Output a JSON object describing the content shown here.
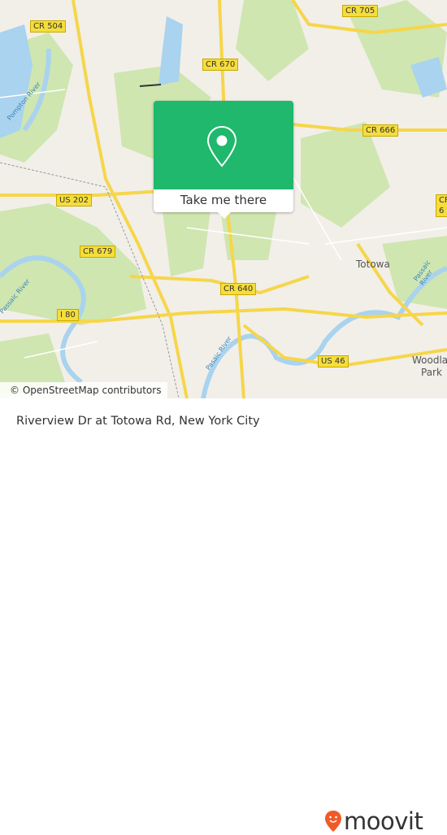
{
  "map": {
    "road_labels": [
      "CR 504",
      "CR 705",
      "CR 670",
      "CR 666",
      "US 202",
      "CR 6",
      "CR 679",
      "CR 640",
      "I 80",
      "US 46"
    ],
    "place_labels": [
      "Totowa",
      "Woodland",
      "Park"
    ],
    "river_labels": [
      "Pompton River",
      "Passaic River",
      "Passaic River",
      "Pasaic River"
    ],
    "colors": {
      "land": "#f2efe9",
      "park": "#cfe6b0",
      "water": "#a9d3ee",
      "road": "#f6d64a"
    }
  },
  "popup": {
    "icon": "map-pin-icon",
    "button_label": "Take me there",
    "color": "#1fb86c"
  },
  "attribution": "© OpenStreetMap contributors",
  "footer": {
    "title": "Riverview Dr at Totowa Rd, New York City",
    "logo_text": "moovit",
    "logo_color": "#f05a28"
  }
}
